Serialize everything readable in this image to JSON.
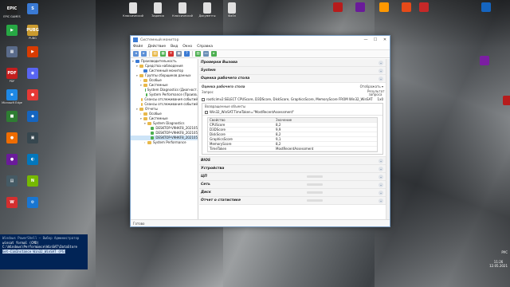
{
  "desktop": {
    "left_icons": [
      {
        "label": "EPIC GAMES",
        "color": "#222222",
        "glyph": "EPIC"
      },
      {
        "label": "",
        "color": "#3a7ad4",
        "glyph": "S"
      },
      {
        "label": "",
        "color": "#27a844",
        "glyph": "▶"
      },
      {
        "label": "PUBG",
        "color": "#c99a2e",
        "glyph": "PUBG"
      },
      {
        "label": "",
        "color": "#5a6b8a",
        "glyph": "▦"
      },
      {
        "label": "",
        "color": "#d83b01",
        "glyph": "▶"
      },
      {
        "label": "PDF",
        "color": "#c41e1e",
        "glyph": "PDF"
      },
      {
        "label": "",
        "color": "#5865f2",
        "glyph": "◉"
      },
      {
        "label": "Microsoft Edge",
        "color": "#1e88e5",
        "glyph": "e"
      },
      {
        "label": "",
        "color": "#e53935",
        "glyph": "●"
      },
      {
        "label": "",
        "color": "#2e7d32",
        "glyph": "■"
      },
      {
        "label": "",
        "color": "#1565c0",
        "glyph": "◆"
      },
      {
        "label": "",
        "color": "#ef6c00",
        "glyph": "●"
      },
      {
        "label": "",
        "color": "#37474f",
        "glyph": "▣"
      },
      {
        "label": "",
        "color": "#6a1b9a",
        "glyph": "●"
      },
      {
        "label": "",
        "color": "#0277bd",
        "glyph": "◐"
      },
      {
        "label": "",
        "color": "#455a64",
        "glyph": "▤"
      },
      {
        "label": "",
        "color": "#76b900",
        "glyph": "N"
      },
      {
        "label": "",
        "color": "#d32f2f",
        "glyph": "W"
      },
      {
        "label": "",
        "color": "#1976d2",
        "glyph": "⚙"
      }
    ],
    "top_icons": [
      {
        "label": "Классический",
        "color": "#e0e0e0"
      },
      {
        "label": "Задания",
        "color": "#e0e0e0"
      },
      {
        "label": "Классический",
        "color": "#e0e0e0"
      },
      {
        "label": "Документы",
        "color": "#e0e0e0"
      },
      {
        "label": "Файл",
        "color": "#e0e0e0"
      }
    ],
    "right_icons": [
      {
        "label": "",
        "color": "#b71c1c"
      },
      {
        "label": "",
        "color": "#6a1b9a"
      },
      {
        "label": "",
        "color": "#ff9800"
      },
      {
        "label": "",
        "color": "#e64a19"
      },
      {
        "label": "",
        "color": "#c62828"
      },
      {
        "label": "",
        "color": "#1565c0"
      },
      {
        "label": "",
        "color": "#7b1fa2"
      },
      {
        "label": "",
        "color": "#b71c1c"
      }
    ],
    "taskbar_labels": {
      "lang": "РУС",
      "time": "11:26",
      "date": "12.05.2021"
    }
  },
  "window": {
    "title": "Системный монитор",
    "controls": [
      "—",
      "☐",
      "✕"
    ],
    "menu": [
      "Файл",
      "Действие",
      "Вид",
      "Окно",
      "Справка"
    ],
    "status": "Готово"
  },
  "tree": [
    {
      "label": "Производительность",
      "level": 0,
      "twisty": "▾",
      "color": "#3a7ad4"
    },
    {
      "label": "Средства наблюдения",
      "level": 1,
      "twisty": "▾",
      "color": "#e8b84a"
    },
    {
      "label": "Системный монитор",
      "level": 2,
      "twisty": "",
      "color": "#3a7ad4"
    },
    {
      "label": "Группы сборщиков данных",
      "level": 1,
      "twisty": "▾",
      "color": "#e8b84a"
    },
    {
      "label": "Особые",
      "level": 2,
      "twisty": "›",
      "color": "#e8b84a"
    },
    {
      "label": "Системные",
      "level": 2,
      "twisty": "▾",
      "color": "#e8b84a"
    },
    {
      "label": "System Diagnostics (Диагност.",
      "level": 3,
      "twisty": "",
      "color": "#4caf50"
    },
    {
      "label": "System Performance (Произв.",
      "level": 3,
      "twisty": "",
      "color": "#4caf50"
    },
    {
      "label": "Сеансы отслеживания событий",
      "level": 2,
      "twisty": "",
      "color": "#e8b84a"
    },
    {
      "label": "Сеансы отслеживания событий",
      "level": 2,
      "twisty": "",
      "color": "#e8b84a"
    },
    {
      "label": "Отчеты",
      "level": 1,
      "twisty": "▾",
      "color": "#e8b84a"
    },
    {
      "label": "Особые",
      "level": 2,
      "twisty": "›",
      "color": "#e8b84a"
    },
    {
      "label": "Системные",
      "level": 2,
      "twisty": "▾",
      "color": "#e8b84a"
    },
    {
      "label": "System Diagnostics",
      "level": 3,
      "twisty": "▾",
      "color": "#e8b84a"
    },
    {
      "label": "DESKTOP-V9HKF8_202105",
      "level": 4,
      "twisty": "",
      "color": "#4caf50"
    },
    {
      "label": "DESKTOP-V9HKF8_202105",
      "level": 4,
      "twisty": "",
      "color": "#4caf50"
    },
    {
      "label": "DESKTOP-V9HKF8_202105",
      "level": 4,
      "twisty": "",
      "color": "#4caf50",
      "selected": true
    },
    {
      "label": "System Performance",
      "level": 3,
      "twisty": "›",
      "color": "#e8b84a"
    }
  ],
  "sections_top": [
    {
      "title": "Проверки Вызова",
      "bar": false
    },
    {
      "title": "System",
      "bar": false
    },
    {
      "title": "Оценка рабочего стола",
      "bar": false
    }
  ],
  "expanded": {
    "title": "Оценка рабочего стола",
    "right": "Отображать ▾",
    "query_label": "Запрос",
    "query_right": "Результат запроса",
    "query": "root\\cimv2:SELECT CPUScore, D3DScore, DiskScore, GraphicsScore, MemoryScore FROM Win32_WinSAT",
    "query_count": "1x0",
    "returned_label": "Возвращенные объекты",
    "object": "Win32_WinSAT.TimeTaken=\"MostRecentAssessment\"",
    "prop_header": [
      "Свойство",
      "Значение"
    ],
    "props": [
      [
        "CPUScore",
        "8,2"
      ],
      [
        "D3DScore",
        "9,9"
      ],
      [
        "DiskScore",
        "8,2"
      ],
      [
        "GraphicsScore",
        "9,1"
      ],
      [
        "MemoryScore",
        "8,2"
      ],
      [
        "TimeTaken",
        "MostRecentAssessment"
      ]
    ]
  },
  "sections_bottom": [
    {
      "title": "BIOS",
      "bar": false
    },
    {
      "title": "Устройства",
      "bar": false
    },
    {
      "title": "ЦП",
      "bar": true
    },
    {
      "title": "Сеть",
      "bar": true
    },
    {
      "title": "Диск",
      "bar": true
    },
    {
      "title": "Отчет о статистике",
      "bar": true
    }
  ],
  "terminal": {
    "lines": [
      "Windows PowerShell — Выбор Администратор",
      "winsat formal (CMD)",
      "C:\\Windows\\Performance\\WinSAT\\DataStore",
      "Get-CimInstance Win32_WinSAT (PS)"
    ]
  }
}
